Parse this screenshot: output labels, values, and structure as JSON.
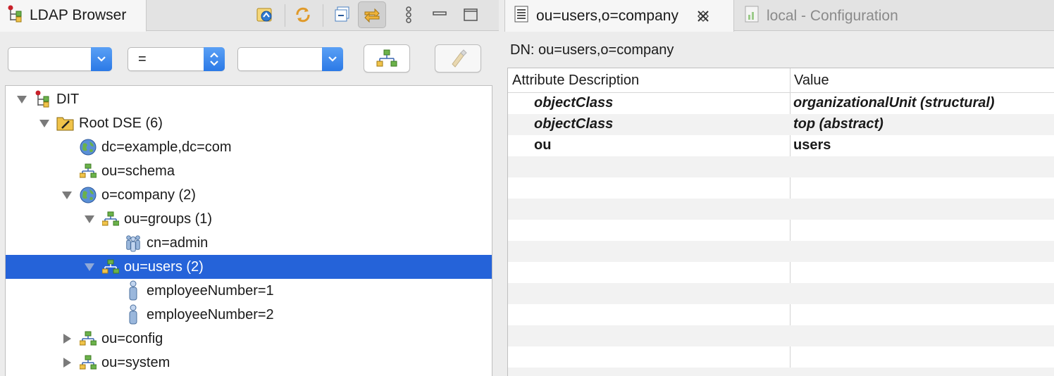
{
  "left_panel": {
    "tab_title": "LDAP Browser",
    "filter": {
      "attribute_value": "",
      "operator_value": "=",
      "value_value": ""
    },
    "tree": [
      {
        "label": "DIT",
        "icon": "dit-icon",
        "twisty": "expanded",
        "depth": 0
      },
      {
        "label": "Root DSE (6)",
        "icon": "root-dse-icon",
        "twisty": "expanded",
        "depth": 1
      },
      {
        "label": "dc=example,dc=com",
        "icon": "globe-icon",
        "twisty": "none",
        "depth": 2
      },
      {
        "label": "ou=schema",
        "icon": "org-unit-icon",
        "twisty": "none",
        "depth": 2
      },
      {
        "label": "o=company (2)",
        "icon": "globe-icon",
        "twisty": "expanded",
        "depth": 2
      },
      {
        "label": "ou=groups (1)",
        "icon": "org-unit-icon",
        "twisty": "expanded",
        "depth": 3
      },
      {
        "label": "cn=admin",
        "icon": "group-icon",
        "twisty": "none",
        "depth": 4
      },
      {
        "label": "ou=users (2)",
        "icon": "org-unit-icon",
        "twisty": "expanded",
        "depth": 3,
        "selected": true
      },
      {
        "label": "employeeNumber=1",
        "icon": "person-icon",
        "twisty": "none",
        "depth": 4
      },
      {
        "label": "employeeNumber=2",
        "icon": "person-icon",
        "twisty": "none",
        "depth": 4
      },
      {
        "label": "ou=config",
        "icon": "org-unit-icon",
        "twisty": "collapsed",
        "depth": 2
      },
      {
        "label": "ou=system",
        "icon": "org-unit-icon",
        "twisty": "collapsed",
        "depth": 2
      }
    ]
  },
  "right_panel": {
    "tabs": [
      {
        "label": "ou=users,o=company",
        "icon": "entry-editor-icon",
        "active": true
      },
      {
        "label": "local - Configuration",
        "icon": "config-icon",
        "active": false
      }
    ],
    "dn_label": "DN: ou=users,o=company",
    "columns": [
      "Attribute Description",
      "Value"
    ],
    "attributes": [
      {
        "name": "objectClass",
        "value": "organizationalUnit (structural)",
        "italic": true
      },
      {
        "name": "objectClass",
        "value": "top (abstract)",
        "italic": true
      },
      {
        "name": "ou",
        "value": "users",
        "italic": false
      }
    ]
  },
  "colors": {
    "selection": "#2563d9",
    "combo_arrow": "#2b79e6"
  }
}
